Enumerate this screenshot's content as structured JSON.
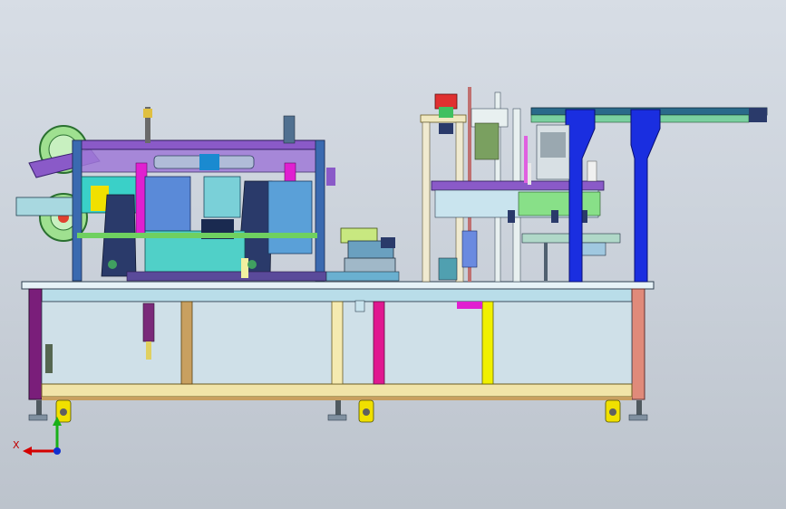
{
  "viewport": {
    "background_top": "#d7dde5",
    "background_bottom": "#bcc3cc"
  },
  "triad": {
    "x_label": "X",
    "x_color": "#d40000",
    "y_color": "#18b018",
    "z_color": "#1030d0"
  },
  "palette": {
    "frame_fill": "#c9e4ee",
    "frame_stroke": "#304050",
    "table_top": "#b8dcea",
    "leg_purple": "#7a1e7a",
    "leg_tan": "#c8a060",
    "leg_cream": "#f4e9a8",
    "leg_magenta": "#e01890",
    "leg_yellow": "#f0f000",
    "leg_pink": "#e090a0",
    "blue_column": "#1a2ee0",
    "machine_purple": "#8a5ac8",
    "teal": "#3ad0c8",
    "green": "#6fd060",
    "magenta": "#e020d0",
    "navy": "#2a3a6a",
    "wheel_yellow": "#f0e000"
  }
}
